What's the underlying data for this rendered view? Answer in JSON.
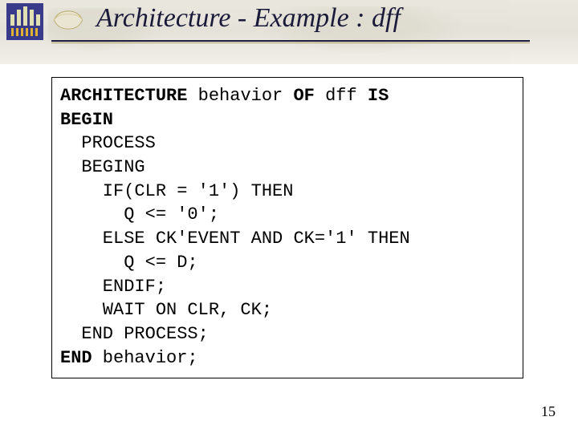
{
  "title": "Architecture - Example : dff",
  "code": {
    "l1a": "ARCHITECTURE",
    "l1b": " behavior ",
    "l1c": "OF",
    "l1d": " dff ",
    "l1e": "IS",
    "l2": "BEGIN",
    "l3": "  PROCESS",
    "l4": "  BEGING",
    "l5": "    IF(CLR = '1') THEN",
    "l6": "      Q <= '0';",
    "l7": "    ELSE CK'EVENT AND CK='1' THEN",
    "l8": "      Q <= D;",
    "l9": "    ENDIF;",
    "l10": "    WAIT ON CLR, CK;",
    "l11": "  END PROCESS;",
    "l12a": "END",
    "l12b": " behavior;"
  },
  "page_number": "15"
}
